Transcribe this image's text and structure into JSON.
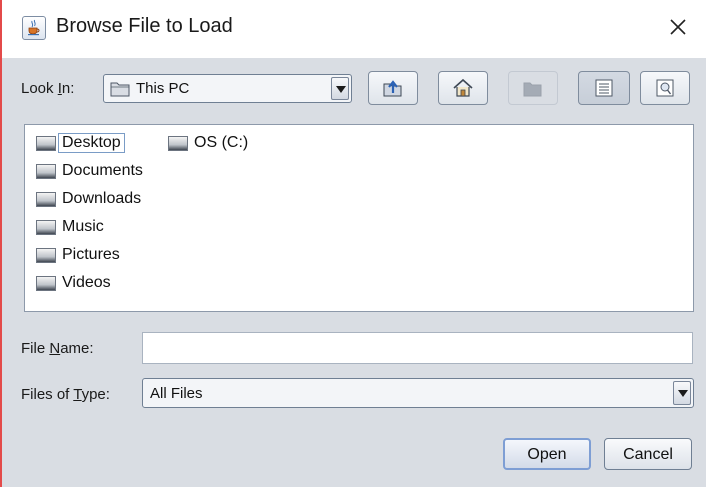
{
  "colors": {
    "window_border_accent": "#e34a4a",
    "dialog_background": "#d9dde3",
    "list_background": "#ffffff",
    "default_button_border": "#7e9ed4"
  },
  "window": {
    "title": "Browse File to Load",
    "icon": "java-cup-icon",
    "close_icon": "close-icon"
  },
  "look_in": {
    "label_prefix": "Look ",
    "label_mnemonic": "I",
    "label_suffix": "n:",
    "selected": "This PC",
    "icon": "folder-icon"
  },
  "toolbar": [
    {
      "name": "up-one-level-button",
      "icon": "folder-up-icon",
      "enabled": true
    },
    {
      "name": "home-button",
      "icon": "home-icon",
      "enabled": true
    },
    {
      "name": "create-new-folder-button",
      "icon": "new-folder-icon",
      "enabled": false
    },
    {
      "name": "list-view-button",
      "icon": "list-view-icon",
      "enabled": true,
      "pressed": true
    },
    {
      "name": "details-view-button",
      "icon": "details-view-icon",
      "enabled": true
    }
  ],
  "files": [
    {
      "name": "Desktop",
      "selected": true,
      "icon": "drive-icon"
    },
    {
      "name": "Documents",
      "icon": "drive-icon"
    },
    {
      "name": "Downloads",
      "icon": "drive-icon"
    },
    {
      "name": "Music",
      "icon": "drive-icon"
    },
    {
      "name": "Pictures",
      "icon": "drive-icon"
    },
    {
      "name": "Videos",
      "icon": "drive-icon"
    },
    {
      "name": "OS (C:)",
      "icon": "drive-icon"
    }
  ],
  "file_name": {
    "label_prefix": "File ",
    "label_mnemonic": "N",
    "label_suffix": "ame:",
    "value": ""
  },
  "files_of_type": {
    "label_prefix": "Files of ",
    "label_mnemonic": "T",
    "label_suffix": "ype:",
    "selected": "All Files"
  },
  "buttons": {
    "open": "Open",
    "cancel": "Cancel"
  }
}
